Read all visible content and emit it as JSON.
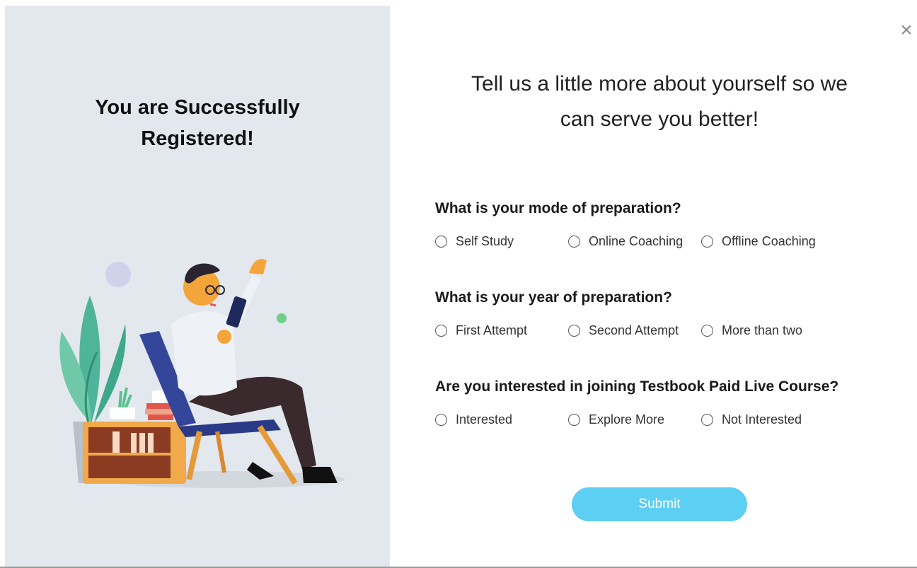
{
  "left": {
    "title": "You are Successfully\nRegistered!"
  },
  "main": {
    "heading": "Tell us a little more about yourself so we\ncan serve you better!",
    "questions": [
      {
        "label": "What is your mode of preparation?",
        "options": [
          "Self Study",
          "Online Coaching",
          "Offline Coaching"
        ]
      },
      {
        "label": "What is your year of preparation?",
        "options": [
          "First Attempt",
          "Second Attempt",
          "More than two"
        ]
      },
      {
        "label": "Are you interested in joining Testbook Paid Live Course?",
        "options": [
          "Interested",
          "Explore More",
          "Not Interested"
        ]
      }
    ],
    "submit_label": "Submit"
  },
  "close_icon": "close-icon",
  "colors": {
    "panel_bg": "#e3e8ef",
    "accent": "#5dcff2"
  }
}
